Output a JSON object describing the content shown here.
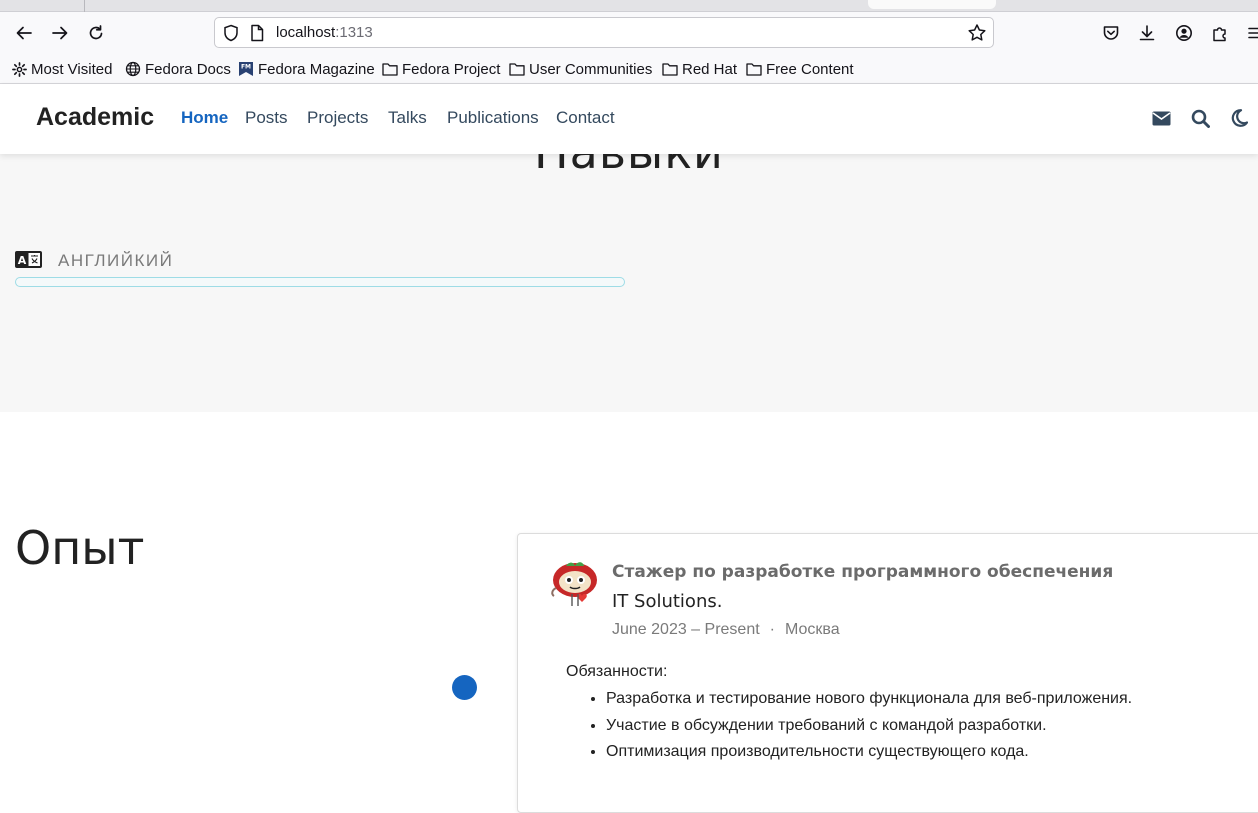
{
  "browser": {
    "url_host": "localhost",
    "url_port": ":1313",
    "bookmarks": [
      {
        "label": "Most Visited",
        "icon": "gear-icon"
      },
      {
        "label": "Fedora Docs",
        "icon": "globe-icon"
      },
      {
        "label": "Fedora Magazine",
        "icon": "fedora-magazine-icon"
      },
      {
        "label": "Fedora Project",
        "icon": "folder-icon"
      },
      {
        "label": "User Communities",
        "icon": "folder-icon"
      },
      {
        "label": "Red Hat",
        "icon": "folder-icon"
      },
      {
        "label": "Free Content",
        "icon": "folder-icon"
      }
    ]
  },
  "site": {
    "brand": "Academic",
    "menu": [
      "Home",
      "Posts",
      "Projects",
      "Talks",
      "Publications",
      "Contact"
    ],
    "active_menu": "Home",
    "accent_color": "#1565c0",
    "header_icons": [
      "envelope-icon",
      "search-icon",
      "moon-icon"
    ]
  },
  "skills": {
    "title": "Навыки",
    "items": [
      {
        "name": "АНГЛИЙКИЙ",
        "icon": "language-icon",
        "level_percent": 0
      }
    ]
  },
  "experience": {
    "title": "Опыт",
    "items": [
      {
        "title": "Стажер по разработке программного обеспечения",
        "company": "IT Solutions.",
        "dates": "June 2023 – Present",
        "separator": "·",
        "location": "Москва",
        "duties_label": "Обязанности:",
        "duties": [
          "Разработка и тестирование нового функционала для веб-приложения.",
          "Участие в обсуждении требований с командой разработки.",
          "Оптимизация производительности существующего кода."
        ]
      }
    ]
  }
}
